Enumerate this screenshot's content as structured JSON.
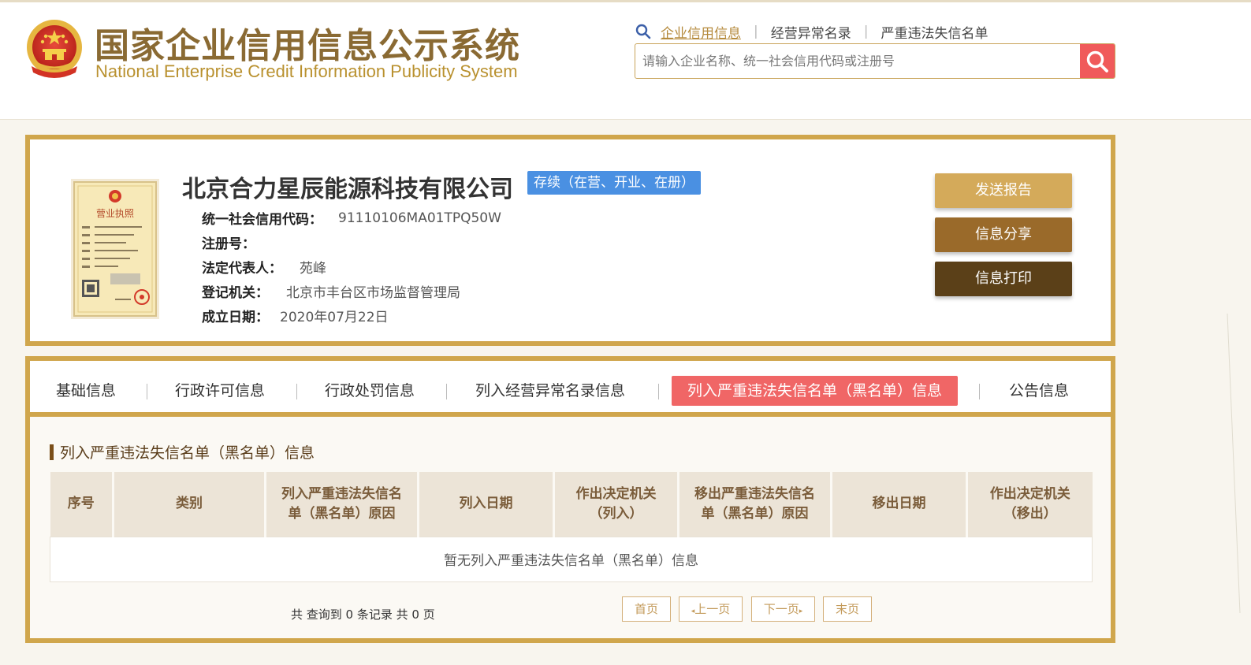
{
  "header": {
    "title_cn": "国家企业信用信息公示系统",
    "title_en": "National Enterprise Credit Information Publicity System",
    "nav": [
      {
        "label": "企业信用信息",
        "active": true
      },
      {
        "label": "经营异常名录",
        "active": false
      },
      {
        "label": "严重违法失信名单",
        "active": false
      }
    ],
    "search": {
      "placeholder": "请输入企业名称、统一社会信用代码或注册号",
      "value": ""
    }
  },
  "company": {
    "name": "北京合力星辰能源科技有限公司",
    "status": "存续（在营、开业、在册）",
    "license_image_title": "营业执照",
    "fields": [
      {
        "label": "统一社会信用代码：",
        "value": "91110106MA01TPQ50W"
      },
      {
        "label": "注册号：",
        "value": ""
      },
      {
        "label": "法定代表人：",
        "value": "苑峰"
      },
      {
        "label": "登记机关：",
        "value": "北京市丰台区市场监督管理局"
      },
      {
        "label": "成立日期：",
        "value": "2020年07月22日"
      }
    ],
    "actions": {
      "send_report": "发送报告",
      "share": "信息分享",
      "print": "信息打印"
    }
  },
  "tabs": [
    {
      "label": "基础信息",
      "active": false
    },
    {
      "label": "行政许可信息",
      "active": false
    },
    {
      "label": "行政处罚信息",
      "active": false
    },
    {
      "label": "列入经营异常名录信息",
      "active": false
    },
    {
      "label": "列入严重违法失信名单（黑名单）信息",
      "active": true
    },
    {
      "label": "公告信息",
      "active": false
    }
  ],
  "section": {
    "title": "列入严重违法失信名单（黑名单）信息",
    "columns": [
      [
        "序号"
      ],
      [
        "类别"
      ],
      [
        "列入严重违法失信名",
        "单（黑名单）原因"
      ],
      [
        "列入日期"
      ],
      [
        "作出决定机关",
        "（列入）"
      ],
      [
        "移出严重违法失信名",
        "单（黑名单）原因"
      ],
      [
        "移出日期"
      ],
      [
        "作出决定机关",
        "（移出）"
      ]
    ],
    "empty_message": "暂无列入严重违法失信名单（黑名单）信息",
    "record_count": "共 查询到 0 条记录 共 0 页",
    "pager": {
      "first": "首页",
      "prev": "上一页",
      "next": "下一页",
      "last": "末页"
    }
  },
  "colors": {
    "brand_gold": "#d0a64c",
    "title_brown": "#8a6a33",
    "status_blue": "#4a90e2",
    "active_tab_red": "#f06666",
    "search_red": "#f05a5a"
  },
  "icons": [
    "national-emblem-icon",
    "search-icon",
    "business-license-image",
    "chevron-left-icon",
    "chevron-right-icon"
  ]
}
